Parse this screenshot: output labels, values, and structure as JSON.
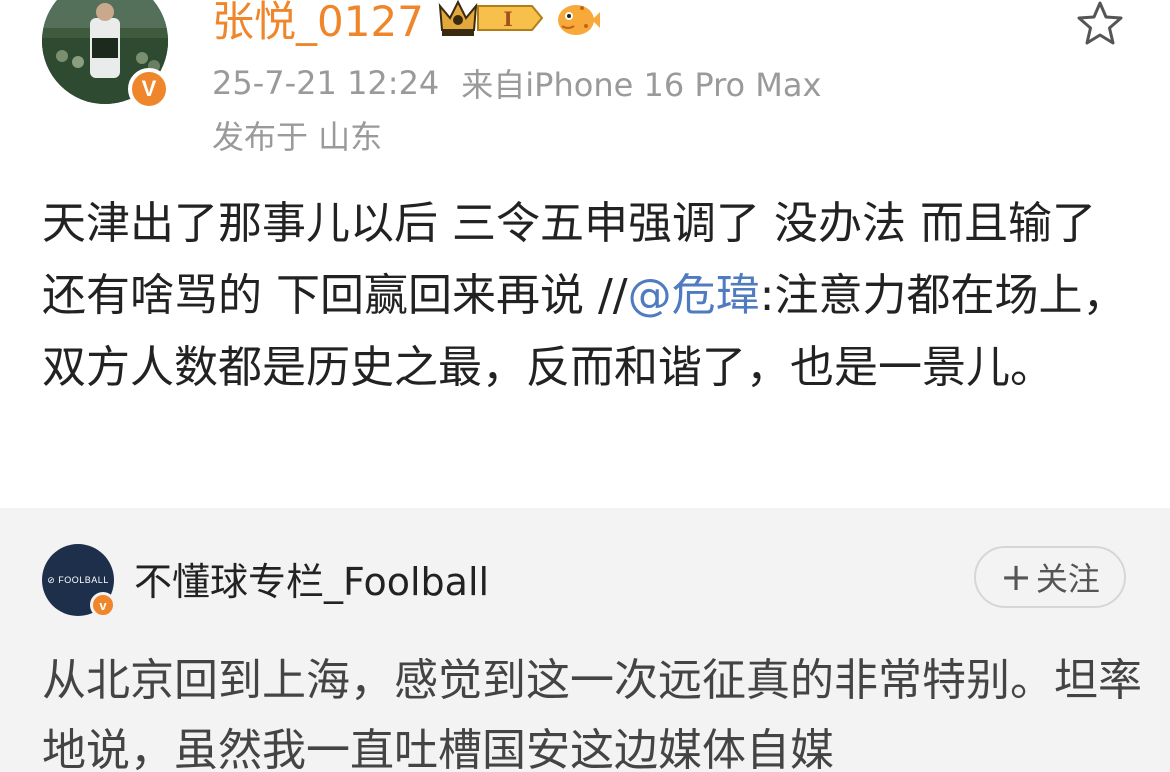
{
  "post": {
    "username": "张悦_0127",
    "crown_badge_letter": "I",
    "timestamp": "25-7-21 12:24",
    "source": "来自iPhone 16 Pro Max",
    "location": "发布于 山东",
    "avatar_verify": "V",
    "body_text": "天津出了那事儿以后 三令五申强调了 没办法 而且输了 还有啥骂的 下回赢回来再说 //",
    "mention": "@危瑋",
    "body_after_mention": ":注意力都在场上，双方人数都是历史之最，反而和谐了，也是一景儿。"
  },
  "repost": {
    "avatar_text": "⊘ FOOLBALL",
    "avatar_verify": "v",
    "username": "不懂球专栏_Foolball",
    "follow_plus": "+",
    "follow_label": "关注",
    "body_text": "从北京回到上海，感觉到这一次远征真的非常特别。坦率地说，虽然我一直吐槽国安这边媒体自媒"
  },
  "colors": {
    "accent_orange": "#f0862b",
    "link_blue": "#4f7bc0",
    "meta_gray": "#9a9a9a",
    "repost_bg": "#f3f3f3"
  }
}
